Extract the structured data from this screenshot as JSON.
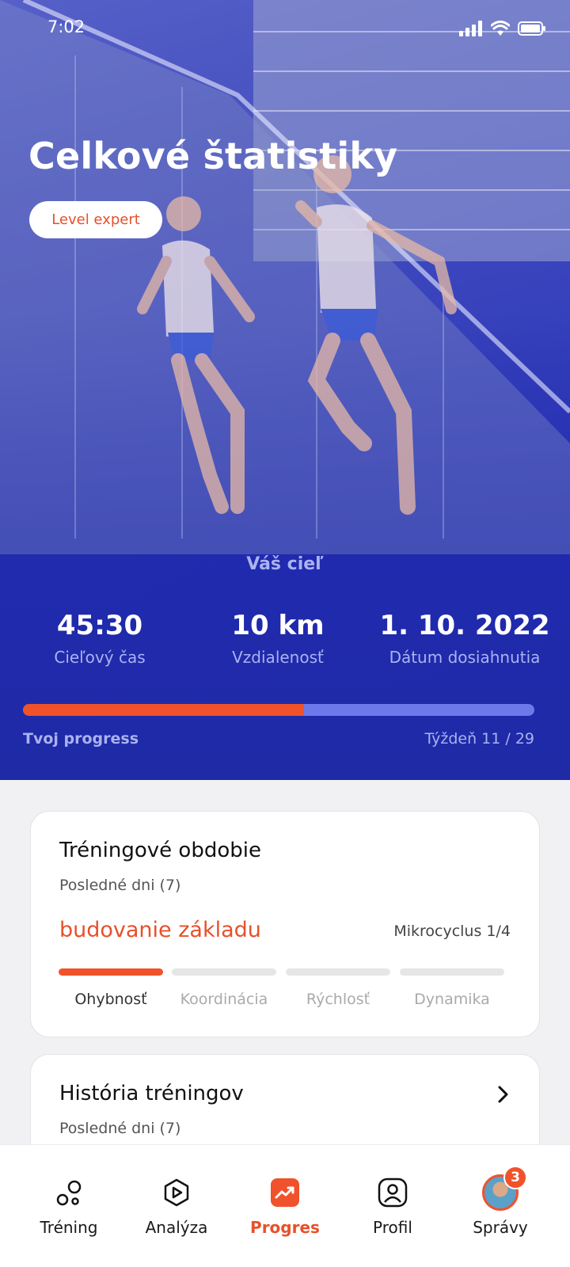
{
  "status_bar": {
    "time": "7:02"
  },
  "hero": {
    "title": "Celkové štatistiky",
    "level_badge": "Level expert"
  },
  "goal": {
    "title": "Váš cieľ",
    "stats": [
      {
        "value": "45:30",
        "label": "Cieľový čas"
      },
      {
        "value": "10 km",
        "label": "Vzdialenosť"
      },
      {
        "value": "1. 10. 2022",
        "label": "Dátum dosiahnutia"
      }
    ],
    "progress_label": "Tvoj progress",
    "week_label": "Týždeň 11 / 29",
    "progress_fraction": 0.55
  },
  "training_period": {
    "title": "Tréningové obdobie",
    "subtitle": "Posledné dni (7)",
    "phase": "budovanie základu",
    "microcycle": "Mikrocyclus 1/4",
    "segments": [
      "Ohybnosť",
      "Koordinácia",
      "Rýchlosť",
      "Dynamika"
    ],
    "active_segment_index": 0
  },
  "training_history": {
    "title": "História tréningov",
    "subtitle": "Posledné dni (7)"
  },
  "bottom_nav": {
    "items": [
      {
        "label": "Tréning",
        "icon": "training-icon"
      },
      {
        "label": "Analýza",
        "icon": "play-hexagon-icon"
      },
      {
        "label": "Progres",
        "icon": "trend-up-icon"
      },
      {
        "label": "Profil",
        "icon": "profile-icon"
      },
      {
        "label": "Správy",
        "icon": "avatar"
      }
    ],
    "active_index": 2,
    "messages_badge": "3"
  },
  "colors": {
    "accent": "#f0522b",
    "hero_blue": "#1f2aa6",
    "progress_track": "#6d79ea"
  }
}
